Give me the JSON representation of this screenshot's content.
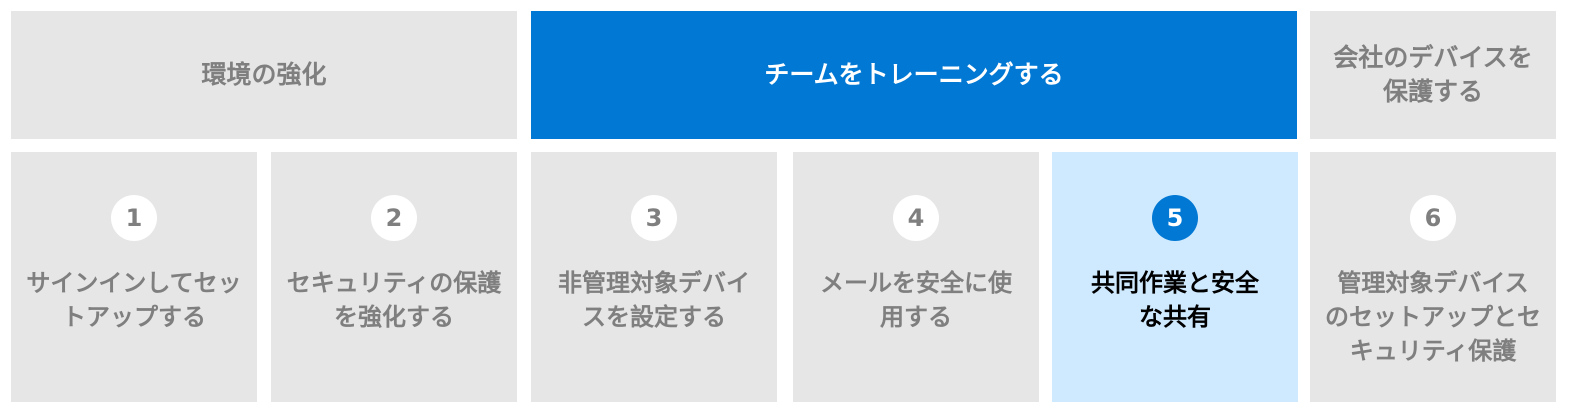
{
  "categories": [
    {
      "label": "環境の強化",
      "active": false
    },
    {
      "label": "チームをトレーニングする",
      "active": true
    },
    {
      "label": "会社のデバイスを\n保護する",
      "active": false
    }
  ],
  "steps": [
    {
      "number": "1",
      "label": "サインインしてセッ\nトアップする",
      "active": false
    },
    {
      "number": "2",
      "label": "セキュリティの保護\nを強化する",
      "active": false
    },
    {
      "number": "3",
      "label": "非管理対象デバイ\nスを設定する",
      "active": false
    },
    {
      "number": "4",
      "label": "メールを安全に使\n用する",
      "active": false
    },
    {
      "number": "5",
      "label": "共同作業と安全\nな共有",
      "active": true
    },
    {
      "number": "6",
      "label": "管理対象デバイス\nのセットアップとセ\nキュリティ保護",
      "active": false
    }
  ],
  "colors": {
    "accent": "#0078d4",
    "inactive_bg": "#e6e6e6",
    "inactive_text": "#7f7f7f",
    "active_step_bg": "#cfe9fe"
  }
}
